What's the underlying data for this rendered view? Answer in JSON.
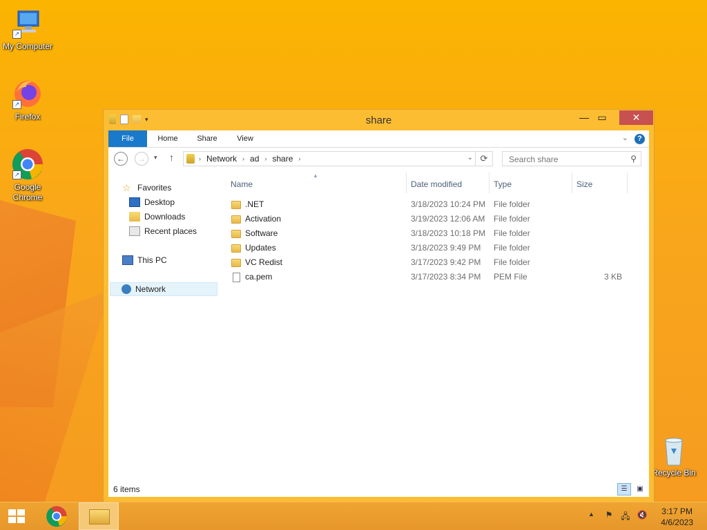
{
  "desktop": {
    "icons": [
      {
        "label": "My Computer"
      },
      {
        "label": "Firefox"
      },
      {
        "label": "Google Chrome"
      },
      {
        "label": "Recycle Bin"
      }
    ]
  },
  "window": {
    "title": "share",
    "ribbon_tabs": [
      "File",
      "Home",
      "Share",
      "View"
    ],
    "breadcrumb": [
      "Network",
      "ad",
      "share"
    ],
    "search_placeholder": "Search share",
    "nav_pane": {
      "favorites": "Favorites",
      "favorites_items": [
        "Desktop",
        "Downloads",
        "Recent places"
      ],
      "this_pc": "This PC",
      "network": "Network"
    },
    "columns": {
      "name": "Name",
      "date": "Date modified",
      "type": "Type",
      "size": "Size"
    },
    "files": [
      {
        "name": ".NET",
        "date": "3/18/2023 10:24 PM",
        "type": "File folder",
        "size": "",
        "kind": "folder"
      },
      {
        "name": "Activation",
        "date": "3/19/2023 12:06 AM",
        "type": "File folder",
        "size": "",
        "kind": "folder"
      },
      {
        "name": "Software",
        "date": "3/18/2023 10:18 PM",
        "type": "File folder",
        "size": "",
        "kind": "folder"
      },
      {
        "name": "Updates",
        "date": "3/18/2023 9:49 PM",
        "type": "File folder",
        "size": "",
        "kind": "folder"
      },
      {
        "name": "VC Redist",
        "date": "3/17/2023 9:42 PM",
        "type": "File folder",
        "size": "",
        "kind": "folder"
      },
      {
        "name": "ca.pem",
        "date": "3/17/2023 8:34 PM",
        "type": "PEM File",
        "size": "3 KB",
        "kind": "file"
      }
    ],
    "status": "6 items"
  },
  "taskbar": {
    "clock_time": "3:17 PM",
    "clock_date": "4/6/2023"
  }
}
